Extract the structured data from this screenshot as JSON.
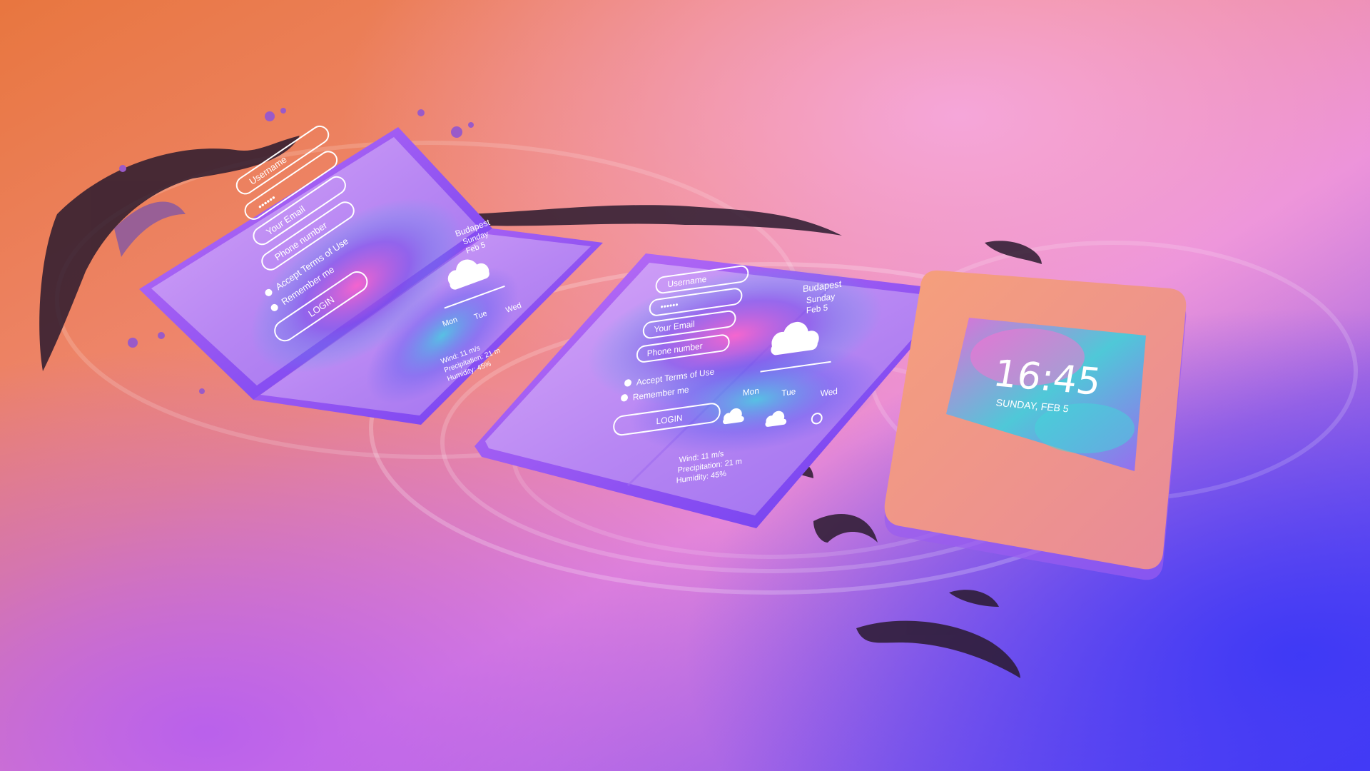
{
  "colors": {
    "background_top_left": "#e8763f",
    "background_top_right": "#f09ad8",
    "background_bottom_left": "#b45cf0",
    "background_bottom_right": "#4a3cf5",
    "device_frame": "#8a4ff0",
    "cover_phone_body": "#f29a76",
    "screen_glow": "#c58cf5",
    "liquid_dark": "#2a1a2e"
  },
  "devices": {
    "left": {
      "username_label": "Username",
      "password_mask": "••••••",
      "email_label": "Your Email",
      "phone_label": "Phone number",
      "accept_terms": "Accept Terms of Use",
      "remember_me": "Remember me",
      "login_label": "LOGIN",
      "city": "Budapest",
      "day": "Sunday",
      "date": "Feb 5",
      "days": [
        "Mon",
        "Tue",
        "Wed"
      ],
      "stats": [
        "Wind: 11 m/s",
        "Precipitation: 21 m",
        "Humidity: 45%"
      ]
    },
    "center": {
      "username_label": "Username",
      "password_mask": "••••••",
      "email_label": "Your Email",
      "phone_label": "Phone number",
      "accept_terms": "Accept Terms of Use",
      "remember_me": "Remember me",
      "login_label": "LOGIN",
      "city": "Budapest",
      "day": "Sunday",
      "date": "Feb 5",
      "days": [
        "Mon",
        "Tue",
        "Wed"
      ],
      "stats": [
        "Wind: 11 m/s",
        "Precipitation: 21 m",
        "Humidity: 45%"
      ]
    },
    "right": {
      "clock": "16:45",
      "date_line": "SUNDAY, FEB 5"
    }
  },
  "icons": {
    "user": "user-icon",
    "lock": "lock-icon",
    "mail": "mail-icon",
    "phone": "phone-icon",
    "check": "check-icon",
    "location": "location-pin-icon",
    "weather_main": "cloud-sun-icon",
    "weather_small": "cloud-sun-small-icon",
    "weather_cloud": "cloud-icon",
    "weather_sun": "sun-icon"
  }
}
